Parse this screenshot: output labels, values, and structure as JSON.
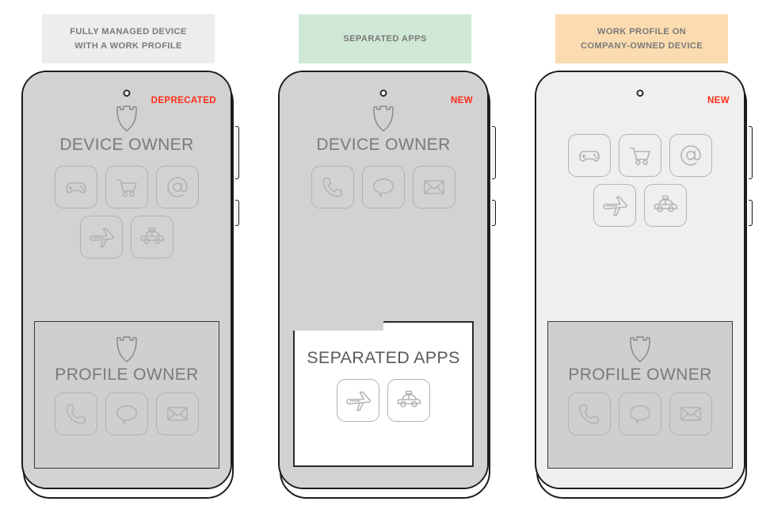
{
  "diagram": {
    "title": "Android Enterprise management modes comparison",
    "columns": [
      {
        "id": "fully-managed-work-profile",
        "banner": {
          "lines": [
            "FULLY MANAGED DEVICE",
            "WITH A WORK PROFILE"
          ],
          "background": "#ededed",
          "text_color": "#7a7a7a"
        },
        "status_tag": {
          "label": "DEPRECATED",
          "color": "#ff2d17"
        },
        "screen_style": "dark",
        "top_section": {
          "shield_icon": "shield-icon",
          "label": "DEVICE OWNER",
          "apps_row_1": [
            "gamepad-icon",
            "shopping-cart-icon",
            "at-sign-icon"
          ],
          "apps_row_2": [
            "airplane-icon",
            "taxi-icon"
          ]
        },
        "bottom_panel": {
          "type": "profile-owner",
          "shield_icon": "shield-icon",
          "label": "PROFILE OWNER",
          "apps": [
            "phone-handset-icon",
            "chat-bubble-icon",
            "envelope-icon"
          ]
        }
      },
      {
        "id": "separated-apps",
        "banner": {
          "lines": [
            "SEPARATED APPS"
          ],
          "background": "#cfe8d5",
          "text_color": "#7a7a7a"
        },
        "status_tag": {
          "label": "NEW",
          "color": "#ff2d17"
        },
        "screen_style": "dark",
        "top_section": {
          "shield_icon": "shield-icon",
          "label": "DEVICE OWNER",
          "apps_row_1": [
            "phone-handset-icon",
            "chat-bubble-icon",
            "envelope-icon"
          ],
          "apps_row_2": []
        },
        "bottom_panel": {
          "type": "folder",
          "label": "SEPARATED APPS",
          "apps": [
            "airplane-icon",
            "taxi-icon"
          ]
        }
      },
      {
        "id": "work-profile-company-owned",
        "banner": {
          "lines": [
            "WORK PROFILE ON",
            "COMPANY-OWNED DEVICE"
          ],
          "background": "#fbdcb0",
          "text_color": "#7a7a7a"
        },
        "status_tag": {
          "label": "NEW",
          "color": "#ff2d17"
        },
        "screen_style": "light",
        "top_section": {
          "shield_icon": null,
          "label": null,
          "apps_row_1": [
            "gamepad-icon",
            "shopping-cart-icon",
            "at-sign-icon"
          ],
          "apps_row_2": [
            "airplane-icon",
            "taxi-icon"
          ]
        },
        "bottom_panel": {
          "type": "profile-owner",
          "shield_icon": "shield-icon",
          "label": "PROFILE OWNER",
          "apps": [
            "phone-handset-icon",
            "chat-bubble-icon",
            "envelope-icon"
          ]
        }
      }
    ],
    "hardware": {
      "camera_icon": "front-camera-icon",
      "volume_button": "volume-button",
      "power_button": "power-button"
    },
    "colors": {
      "screen_dark": "#d2d2d2",
      "screen_light": "#efefef",
      "panel_fill": "#cfcfcf",
      "frame_stroke": "#1c1c1c",
      "icon_stroke": "#b2b2b2",
      "label_text": "#7a7a7a",
      "accent_red": "#ff2d17"
    }
  }
}
